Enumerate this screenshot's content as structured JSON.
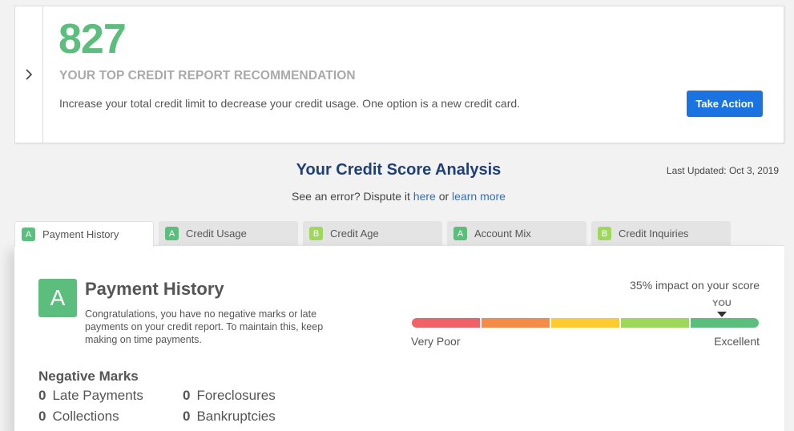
{
  "recommendation": {
    "score": "827",
    "heading": "YOUR TOP CREDIT REPORT RECOMMENDATION",
    "text": "Increase your total credit limit to decrease your credit usage. One option is a new credit card.",
    "action_label": "Take Action",
    "toggle_icon": "chevron-right-icon"
  },
  "analysis": {
    "title": "Your Credit Score Analysis",
    "last_updated": "Last Updated: Oct 3, 2019",
    "dispute_prefix": "See an error? Dispute it ",
    "dispute_link": "here",
    "dispute_mid": " or ",
    "learn_more_link": "learn more"
  },
  "tabs": [
    {
      "grade": "A",
      "label": "Payment History",
      "active": true,
      "badge_color": "#5cbe7d"
    },
    {
      "grade": "A",
      "label": "Credit Usage",
      "active": false,
      "badge_color": "#5cbe7d"
    },
    {
      "grade": "B",
      "label": "Credit Age",
      "active": false,
      "badge_color": "#9ed85a"
    },
    {
      "grade": "A",
      "label": "Account Mix",
      "active": false,
      "badge_color": "#5cbe7d"
    },
    {
      "grade": "B",
      "label": "Credit Inquiries",
      "active": false,
      "badge_color": "#9ed85a"
    }
  ],
  "panel": {
    "grade": "A",
    "title": "Payment History",
    "description": "Congratulations, you have no negative marks or late payments on your credit report. To maintain this, keep making on time payments.",
    "impact": "35% impact on your score",
    "you_label": "YOU",
    "gauge": {
      "low_label": "Very Poor",
      "high_label": "Excellent",
      "segment_colors": [
        "#f0626a",
        "#f28c48",
        "#fccb31",
        "#9ed85a",
        "#5cbe7d"
      ],
      "current_level": "Excellent"
    },
    "negative_marks": {
      "title": "Negative Marks",
      "items": [
        {
          "count": "0",
          "label": "Late Payments"
        },
        {
          "count": "0",
          "label": "Foreclosures"
        },
        {
          "count": "0",
          "label": "Collections"
        },
        {
          "count": "0",
          "label": "Bankruptcies"
        }
      ]
    }
  },
  "colors": {
    "score_green": "#5cbe7d",
    "action_blue": "#1a73e0",
    "title_navy": "#1f3f7a",
    "link_blue": "#2a6fc9"
  }
}
